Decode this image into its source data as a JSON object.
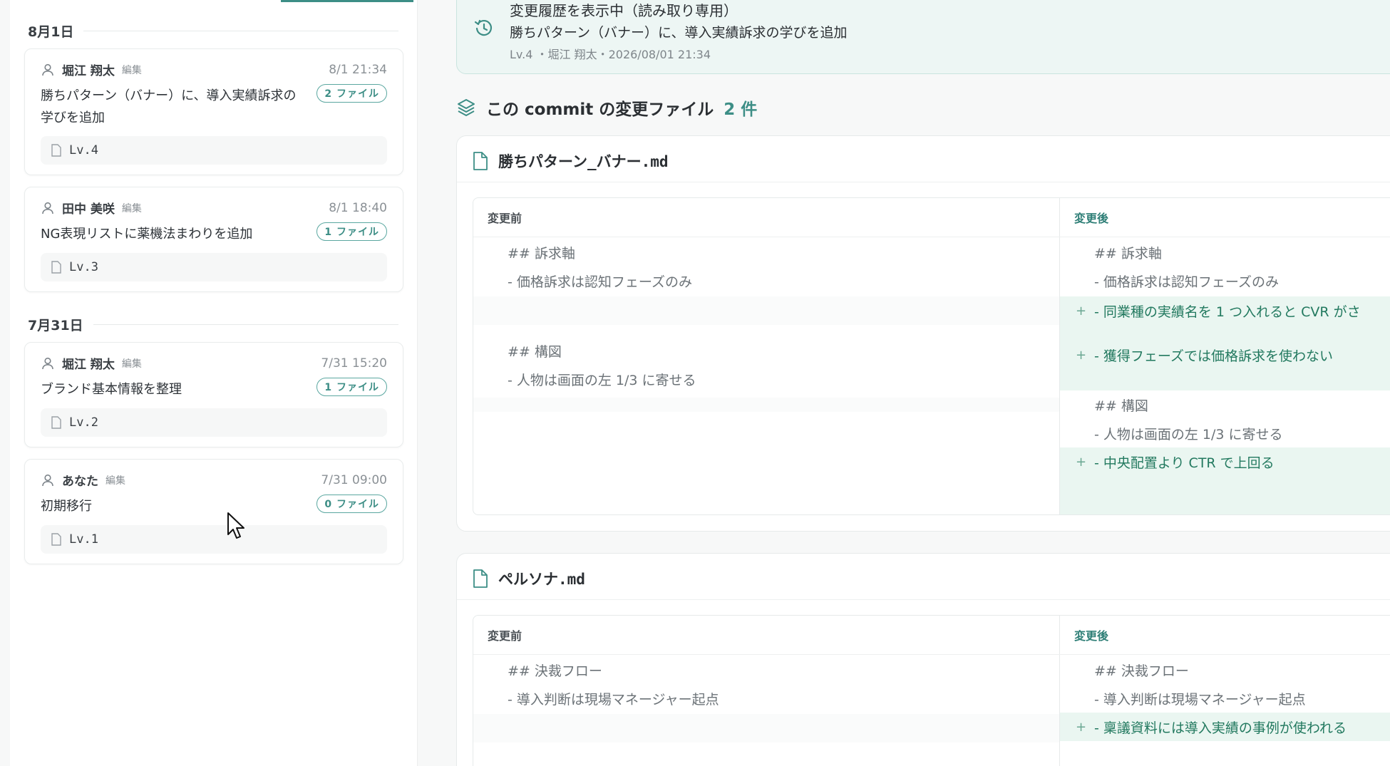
{
  "left": {
    "groups": [
      {
        "date": "8月1日",
        "commits": [
          {
            "author": "堀江 翔太",
            "action": "編集",
            "time": "8/1 21:34",
            "message": "勝ちパターン（バナー）に、導入実績訴求の学びを追加",
            "files": "2 ファイル",
            "level": "Lv.4"
          },
          {
            "author": "田中 美咲",
            "action": "編集",
            "time": "8/1 18:40",
            "message": "NG表現リストに薬機法まわりを追加",
            "files": "1 ファイル",
            "level": "Lv.3"
          }
        ]
      },
      {
        "date": "7月31日",
        "commits": [
          {
            "author": "堀江 翔太",
            "action": "編集",
            "time": "7/31 15:20",
            "message": "ブランド基本情報を整理",
            "files": "1 ファイル",
            "level": "Lv.2"
          },
          {
            "author": "あなた",
            "action": "編集",
            "time": "7/31 09:00",
            "message": "初期移行",
            "files": "0 ファイル",
            "level": "Lv.1"
          }
        ]
      }
    ]
  },
  "banner": {
    "title": "変更履歴を表示中（読み取り専用）",
    "message": "勝ちパターン（バナー）に、導入実績訴求の学びを追加",
    "meta": "Lv.4 ・堀江 翔太・2026/08/01 21:34"
  },
  "section": {
    "title": "この commit の変更ファイル",
    "count": "2 件"
  },
  "files": [
    {
      "name": "勝ちパターン_バナー.md",
      "before_label": "変更前",
      "after_label": "変更後",
      "before_lines": [
        "## 訴求軸",
        "- 価格訴求は認知フェーズのみ",
        "",
        "## 構図",
        "- 人物は画面の左 1/3 に寄せる"
      ],
      "after_lines": [
        "## 訴求軸",
        "- 価格訴求は認知フェーズのみ",
        "- 同業種の実績名を 1 つ入れると CVR がさ",
        "- 獲得フェーズでは価格訴求を使わない",
        "## 構図",
        "- 人物は画面の左 1/3 に寄せる",
        "- 中央配置より CTR で上回る"
      ]
    },
    {
      "name": "ペルソナ.md",
      "before_label": "変更前",
      "after_label": "変更後",
      "before_lines": [
        "## 決裁フロー",
        "- 導入判断は現場マネージャー起点"
      ],
      "after_lines": [
        "## 決裁フロー",
        "- 導入判断は現場マネージャー起点",
        "- 稟議資料には導入実績の事例が使われる"
      ]
    }
  ],
  "diff_plus": "+",
  "icons": [
    "user-icon",
    "document-icon",
    "history-icon",
    "layers-icon",
    "mouse-cursor-icon"
  ],
  "colors": {
    "accent": "#3d8e86",
    "added_bg": "#eaf6f1",
    "added_text": "#22795f",
    "banner_bg": "#edf6f4"
  }
}
